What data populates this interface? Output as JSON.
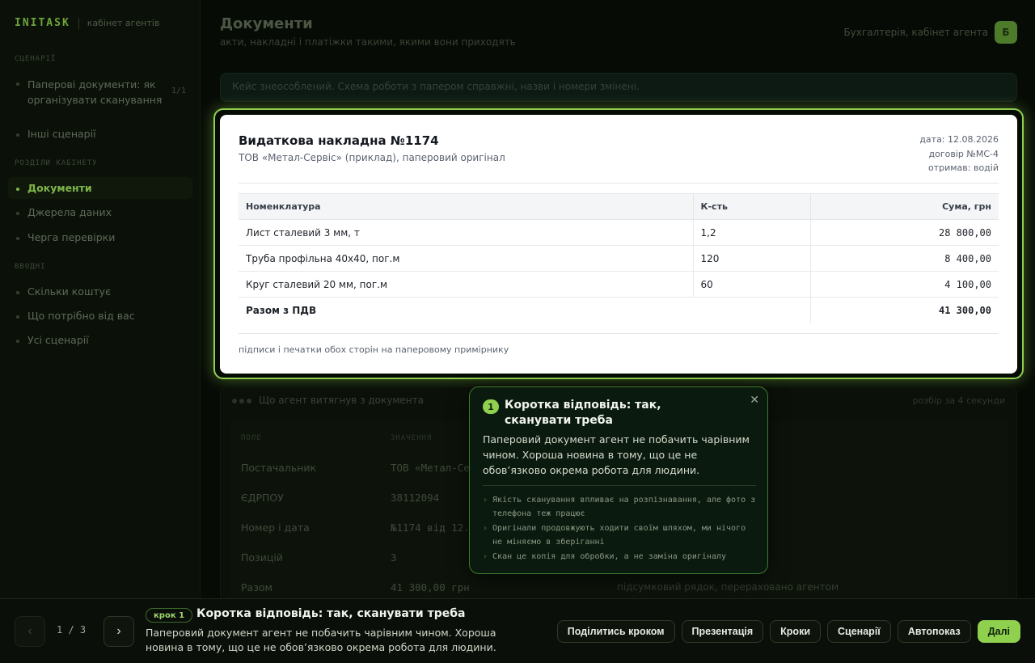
{
  "brand": {
    "logo": "INITASK",
    "subtitle": "кабінет агентів"
  },
  "sidebar": {
    "sections": [
      {
        "title": "СЦЕНАРІЇ"
      },
      {
        "title": "РОЗДІЛИ КАБІНЕТУ"
      },
      {
        "title": "ВВОДНІ"
      }
    ],
    "items": [
      {
        "label": "Паперові документи: як організувати сканування",
        "count": "1/1"
      },
      {
        "label": "Інші сценарії"
      },
      {
        "label": "Документи"
      },
      {
        "label": "Джерела даних"
      },
      {
        "label": "Черга перевірки"
      },
      {
        "label": "Скільки коштує"
      },
      {
        "label": "Що потрібно від вас"
      },
      {
        "label": "Усі сценарії"
      }
    ]
  },
  "header": {
    "title": "Документи",
    "subtitle": "акти, накладні і платіжки такими, якими вони приходять",
    "user_label": "Бухгалтерія, кабінет агента",
    "avatar": "Б"
  },
  "notice": "Кейс знеособлений. Схема роботи з папером справжні, назви і номери змінені.",
  "document": {
    "title": "Видаткова накладна №1174",
    "subtitle": "ТОВ «Метал-Сервіс» (приклад), паперовий оригінал",
    "meta": {
      "date": "дата: 12.08.2026",
      "contract": "договір №МС-4",
      "received": "отримав: водій"
    },
    "columns": [
      "Номенклатура",
      "К-сть",
      "Сума, грн"
    ],
    "rows": [
      {
        "name": "Лист сталевий 3 мм, т",
        "qty": "1,2",
        "sum": "28 800,00"
      },
      {
        "name": "Труба профільна 40х40, пог.м",
        "qty": "120",
        "sum": "8 400,00"
      },
      {
        "name": "Круг сталевий 20 мм, пог.м",
        "qty": "60",
        "sum": "4 100,00"
      }
    ],
    "total_label": "Разом з ПДВ",
    "total_value": "41 300,00",
    "footer": "підписи і печатки обох сторін на паперовому примірнику"
  },
  "extracted": {
    "title": "Що агент витягнув з документа",
    "right_note": "розбір за 4 секунди",
    "col_field": "ПОЛЕ",
    "col_value": "ЗНАЧЕННЯ",
    "rows": [
      {
        "field": "Постачальник",
        "value": "ТОВ «Метал-Се"
      },
      {
        "field": "ЄДРПОУ",
        "value": "38112094"
      },
      {
        "field": "Номер і дата",
        "value": "№1174 від 12."
      },
      {
        "field": "Позицій",
        "value": "3"
      },
      {
        "field": "Разом",
        "value": "41 300,00 грн",
        "note": "підсумковий рядок, перераховано агентом"
      }
    ]
  },
  "popover": {
    "badge": "1",
    "title": "Коротка відповідь: так, сканувати треба",
    "body": "Паперовий документ агент не побачить чарівним чином. Хороша новина в тому, що це не обов’язково окрема робота для людини.",
    "points": [
      "Якість сканування впливає на розпізнавання, але фото з телефона теж працює",
      "Оригінали продовжують ходити своїм шляхом, ми нічого не міняємо в зберіганні",
      "Скан це копія для обробки, а не заміна оригіналу"
    ]
  },
  "bottombar": {
    "prev_icon": "chevron-left-icon",
    "next_icon": "chevron-right-icon",
    "counter": "1 / 3",
    "step_chip": "крок 1",
    "step_title": "Коротка відповідь: так, сканувати треба",
    "step_desc": "Паперовий документ агент не побачить чарівним чином. Хороша новина в тому, що це не обов’язково окрема робота для людини.",
    "actions": [
      "Поділитись кроком",
      "Презентація",
      "Кроки",
      "Сценарії",
      "Автопоказ",
      "Далі"
    ]
  },
  "colors": {
    "accent": "#8fd14f",
    "background": "#070b06",
    "card": "#ffffff"
  }
}
